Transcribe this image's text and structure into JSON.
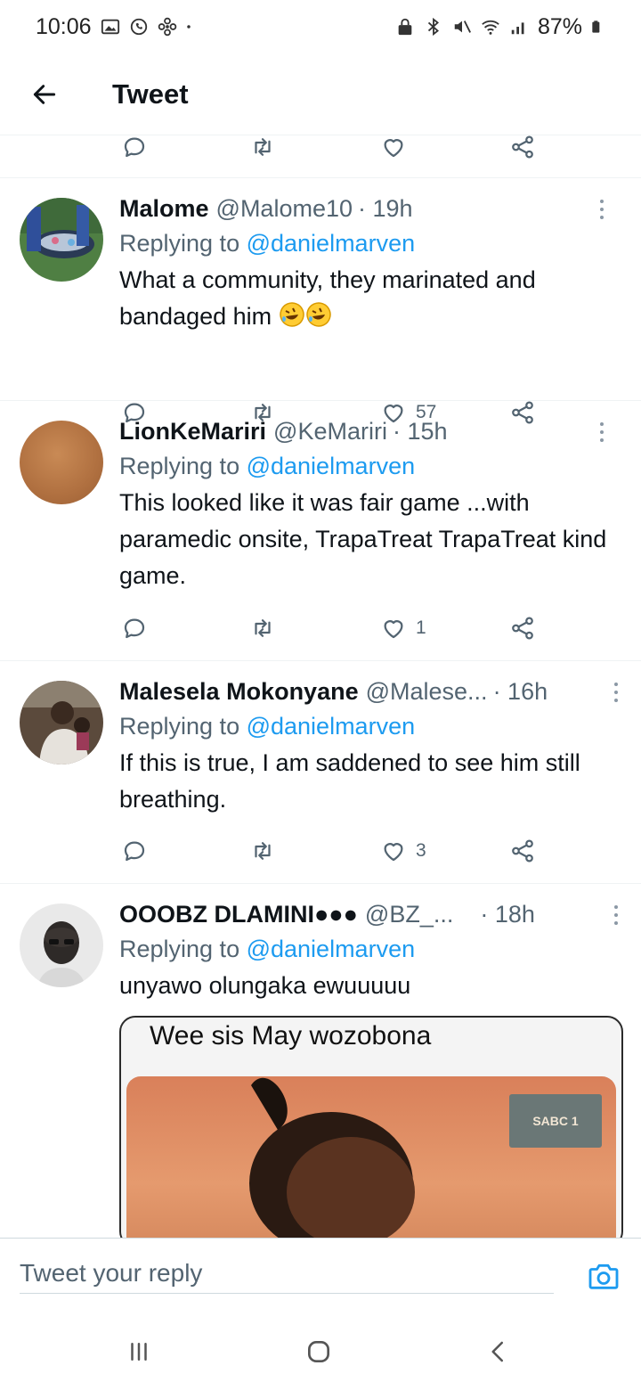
{
  "status_bar": {
    "time": "10:06",
    "battery": "87%",
    "left_icons": [
      "gallery-icon",
      "whatsapp-icon",
      "fan-icon",
      "dot-icon"
    ],
    "right_icons": [
      "lock-icon",
      "bluetooth-icon",
      "mute-icon",
      "wifi-icon",
      "signal-icon",
      "battery-icon"
    ]
  },
  "header": {
    "title": "Tweet"
  },
  "tweets": [
    {
      "name": "Malome",
      "handle": "@Malome10",
      "time": "· 19h",
      "replying_prefix": "Replying to ",
      "replying_to": "@danielmarven",
      "text": "What a community, they marinated and bandaged him",
      "emojis": [
        "rofl-emoji",
        "rofl-emoji"
      ],
      "likes": "57"
    },
    {
      "name": "LionKeMariri",
      "handle": "@KeMariri",
      "time": "· 15h",
      "replying_prefix": "Replying to ",
      "replying_to": "@danielmarven",
      "text": "This looked like it was fair game ...with paramedic onsite, TrapaTreat TrapaTreat kind game.",
      "likes": "1"
    },
    {
      "name": "Malesela Mokonyane",
      "handle": "@Malese...",
      "time": "· 16h",
      "replying_prefix": "Replying to ",
      "replying_to": "@danielmarven",
      "text": "If this is true, I am saddened to see him still breathing.",
      "likes": "3"
    },
    {
      "name": "OOOBZ DLAMINI●●●",
      "handle": "@BZ_...",
      "time": "· 18h",
      "replying_prefix": "Replying to ",
      "replying_to": "@danielmarven",
      "text": "unyawo olungaka ewuuuuu",
      "media_caption": "Wee sis May wozobona",
      "media_watermark": "SABC 1"
    }
  ],
  "reply_bar": {
    "placeholder": "Tweet your reply"
  },
  "navbar": {
    "buttons": [
      "recent-apps-button",
      "home-button",
      "back-button"
    ]
  },
  "colors": {
    "accent": "#1d9bf0",
    "secondary_text": "#536471",
    "divider": "#eff3f4"
  }
}
